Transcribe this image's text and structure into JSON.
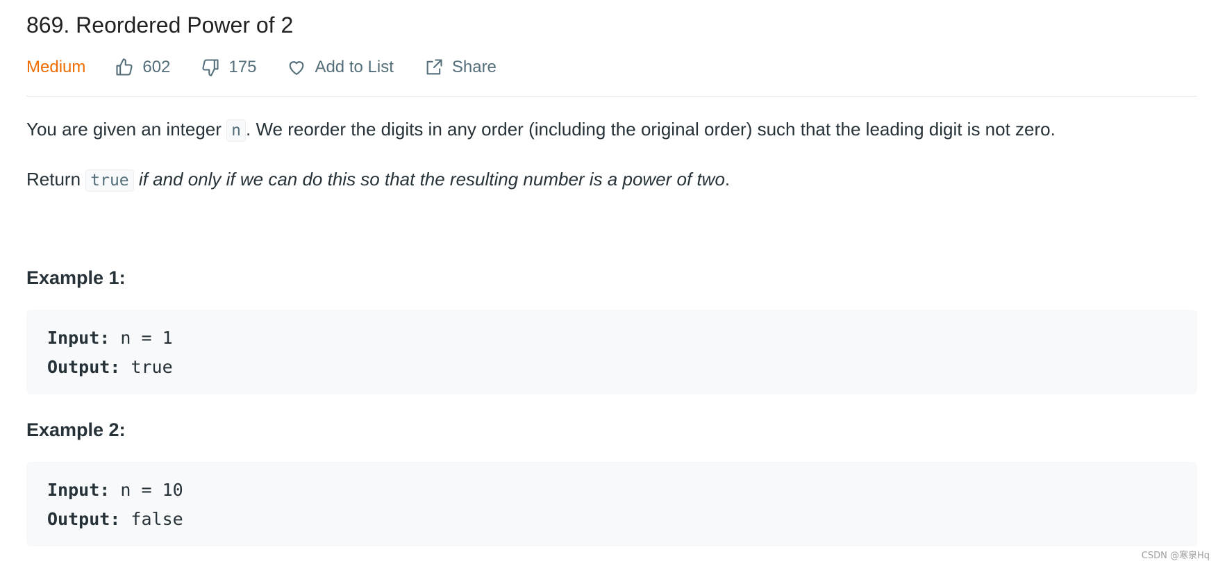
{
  "problem": {
    "title": "869. Reordered Power of 2",
    "difficulty": "Medium",
    "likes": "602",
    "dislikes": "175",
    "add_to_list_label": "Add to List",
    "share_label": "Share"
  },
  "description": {
    "p1_before": "You are given an integer ",
    "p1_code": "n",
    "p1_after": ". We reorder the digits in any order (including the original order) such that the leading digit is not zero.",
    "p2_before": "Return ",
    "p2_code": "true",
    "p2_italic": "if and only if we can do this so that the resulting number is a power of two",
    "p2_after": "."
  },
  "examples": [
    {
      "title": "Example 1:",
      "input_label": "Input:",
      "input_value": " n = 1",
      "output_label": "Output:",
      "output_value": " true"
    },
    {
      "title": "Example 2:",
      "input_label": "Input:",
      "input_value": " n = 10",
      "output_label": "Output:",
      "output_value": " false"
    }
  ],
  "icons": {
    "like": "thumbs-up-icon",
    "dislike": "thumbs-down-icon",
    "add_to_list": "heart-icon",
    "share": "share-icon"
  },
  "colors": {
    "difficulty_medium": "#ef6c00",
    "text": "#263238",
    "meta": "#546e7a",
    "code_bg": "#f7f9fa"
  },
  "watermark": "CSDN @寒泉Hq"
}
